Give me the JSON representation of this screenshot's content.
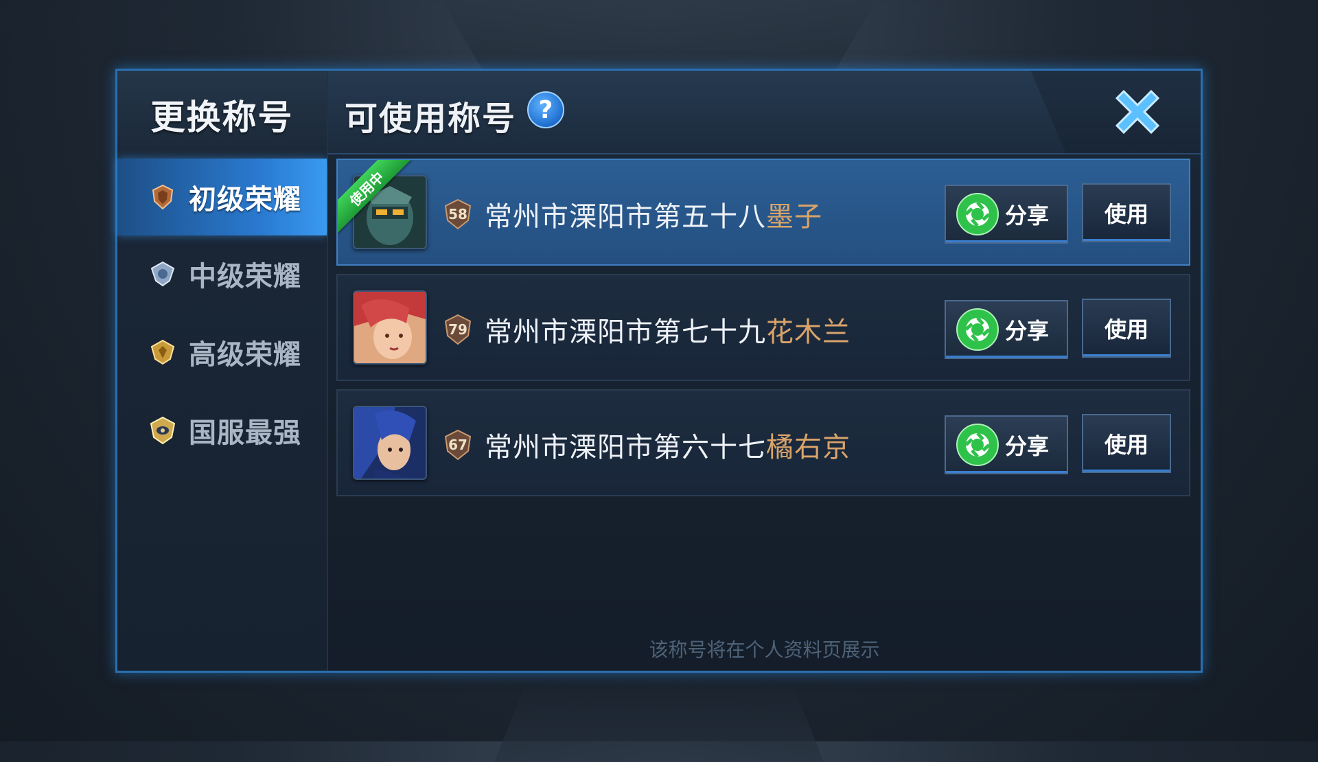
{
  "sidebar": {
    "title": "更换称号",
    "items": [
      {
        "label": "初级荣耀",
        "icon": "bronze-rank-icon",
        "active": true
      },
      {
        "label": "中级荣耀",
        "icon": "silver-rank-icon",
        "active": false
      },
      {
        "label": "高级荣耀",
        "icon": "gold-rank-icon",
        "active": false
      },
      {
        "label": "国服最强",
        "icon": "top-rank-icon",
        "active": false
      }
    ]
  },
  "header": {
    "title": "可使用称号",
    "help_label": "?",
    "close_icon": "close-icon"
  },
  "titles": [
    {
      "level": "58",
      "prefix": "常州市溧阳市第五十八",
      "hero": "墨子",
      "in_use": true,
      "in_use_label": "使用中",
      "share_label": "分享",
      "use_label": "使用"
    },
    {
      "level": "79",
      "prefix": "常州市溧阳市第七十九",
      "hero": "花木兰",
      "in_use": false,
      "share_label": "分享",
      "use_label": "使用"
    },
    {
      "level": "67",
      "prefix": "常州市溧阳市第六十七",
      "hero": "橘右京",
      "in_use": false,
      "share_label": "分享",
      "use_label": "使用"
    }
  ],
  "footer": {
    "note": "该称号将在个人资料页展示"
  },
  "colors": {
    "accent": "#2a7bd2",
    "hero_name": "#d9a46a",
    "in_use_tag": "#2fb84a"
  }
}
